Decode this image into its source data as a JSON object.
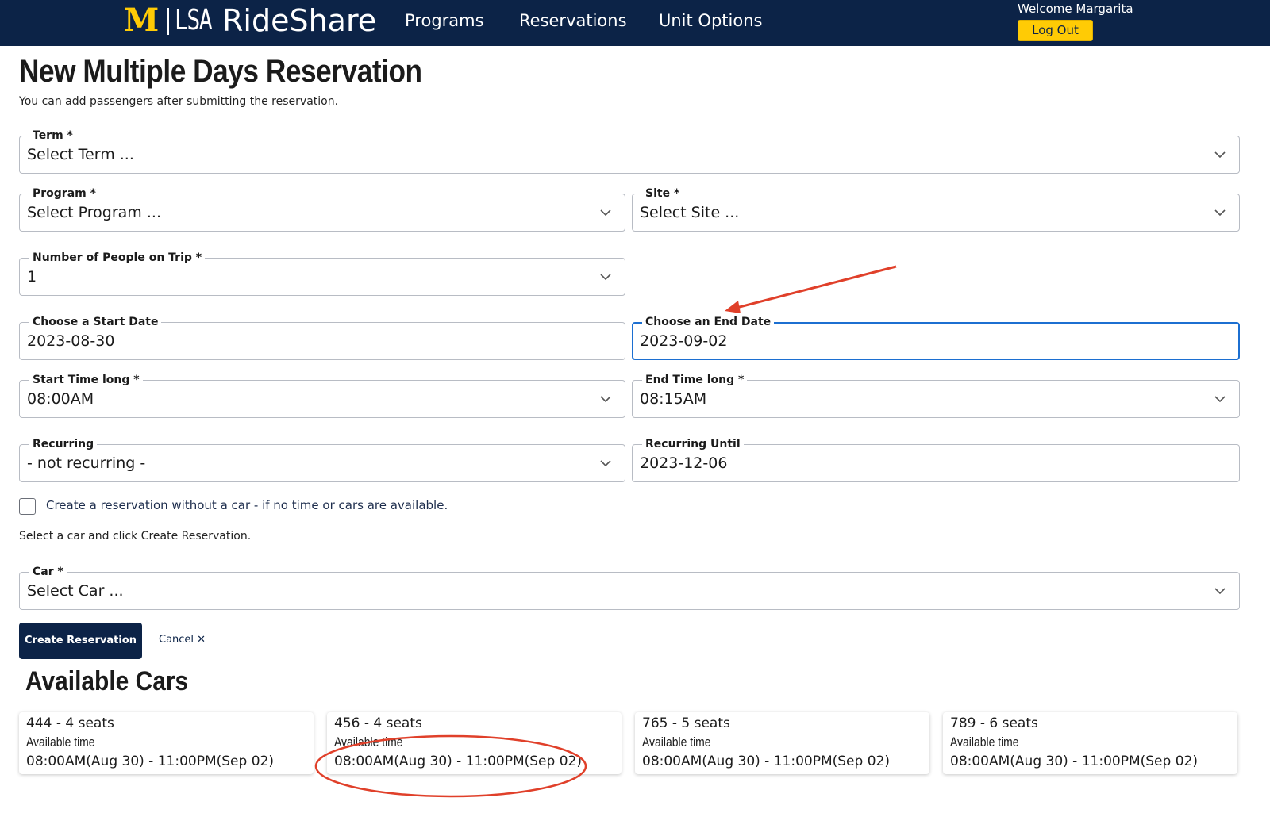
{
  "header": {
    "logo_mark": "M",
    "logo_unit": "LSA",
    "app_name": "RideShare",
    "nav": [
      "Programs",
      "Reservations",
      "Unit Options"
    ],
    "welcome": "Welcome Margarita",
    "logout": "Log Out"
  },
  "page": {
    "title": "New Multiple Days Reservation",
    "subtitle": "You can add passengers after submitting the reservation."
  },
  "form": {
    "term": {
      "label": "Term *",
      "value": "Select Term ..."
    },
    "program": {
      "label": "Program *",
      "value": "Select Program ..."
    },
    "site": {
      "label": "Site *",
      "value": "Select Site ..."
    },
    "people": {
      "label": "Number of People on Trip *",
      "value": "1"
    },
    "start_date": {
      "label": "Choose a Start Date",
      "value": "2023-08-30"
    },
    "end_date": {
      "label": "Choose an End Date",
      "value": "2023-09-02"
    },
    "start_time": {
      "label": "Start Time long *",
      "value": "08:00AM"
    },
    "end_time": {
      "label": "End Time long *",
      "value": "08:15AM"
    },
    "recurring": {
      "label": "Recurring",
      "value": "- not recurring -"
    },
    "recurring_until": {
      "label": "Recurring Until",
      "value": "2023-12-06"
    },
    "no_car_checkbox": {
      "label": "Create a reservation without a car - if no time or cars are available.",
      "checked": false
    },
    "instruction": "Select a car and click Create Reservation.",
    "car": {
      "label": "Car *",
      "value": "Select Car ..."
    },
    "create_button": "Create Reservation",
    "cancel_button": "Cancel ✕"
  },
  "available_cars": {
    "title": "Available Cars",
    "cars": [
      {
        "title": "444 - 4 seats",
        "label": "Available time",
        "time": "08:00AM(Aug 30) - 11:00PM(Sep 02)"
      },
      {
        "title": "456 - 4 seats",
        "label": "Available time",
        "time": "08:00AM(Aug 30) - 11:00PM(Sep 02)"
      },
      {
        "title": "765 - 5 seats",
        "label": "Available time",
        "time": "08:00AM(Aug 30) - 11:00PM(Sep 02)"
      },
      {
        "title": "789 - 6 seats",
        "label": "Available time",
        "time": "08:00AM(Aug 30) - 11:00PM(Sep 02)"
      }
    ]
  },
  "colors": {
    "header_bg": "#0c2347",
    "maize": "#ffcb05",
    "focus_border": "#1c6fd1",
    "annotation": "#e0402a"
  }
}
